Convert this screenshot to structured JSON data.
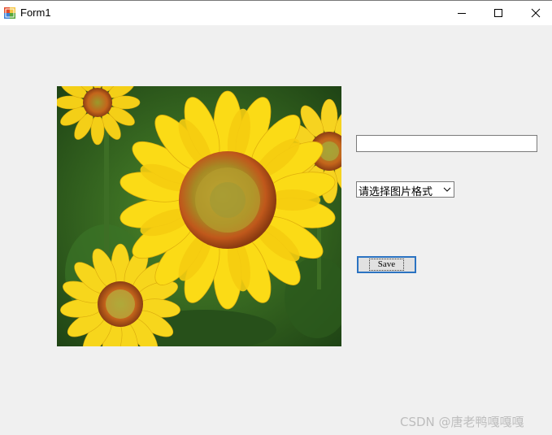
{
  "window": {
    "title": "Form1"
  },
  "title_buttons": {
    "minimize_icon": "minimize-icon",
    "maximize_icon": "maximize-icon",
    "close_icon": "close-icon"
  },
  "form": {
    "text_input": {
      "value": ""
    },
    "format_select": {
      "selected": "请选择图片格式"
    },
    "save_button": {
      "label": "Save"
    },
    "image": {
      "subject": "sunflowers"
    }
  },
  "watermark": "CSDN @唐老鸭嘎嘎嘎",
  "colors": {
    "button_border": "#2b73c2",
    "window_bg": "#f0f0f0"
  }
}
